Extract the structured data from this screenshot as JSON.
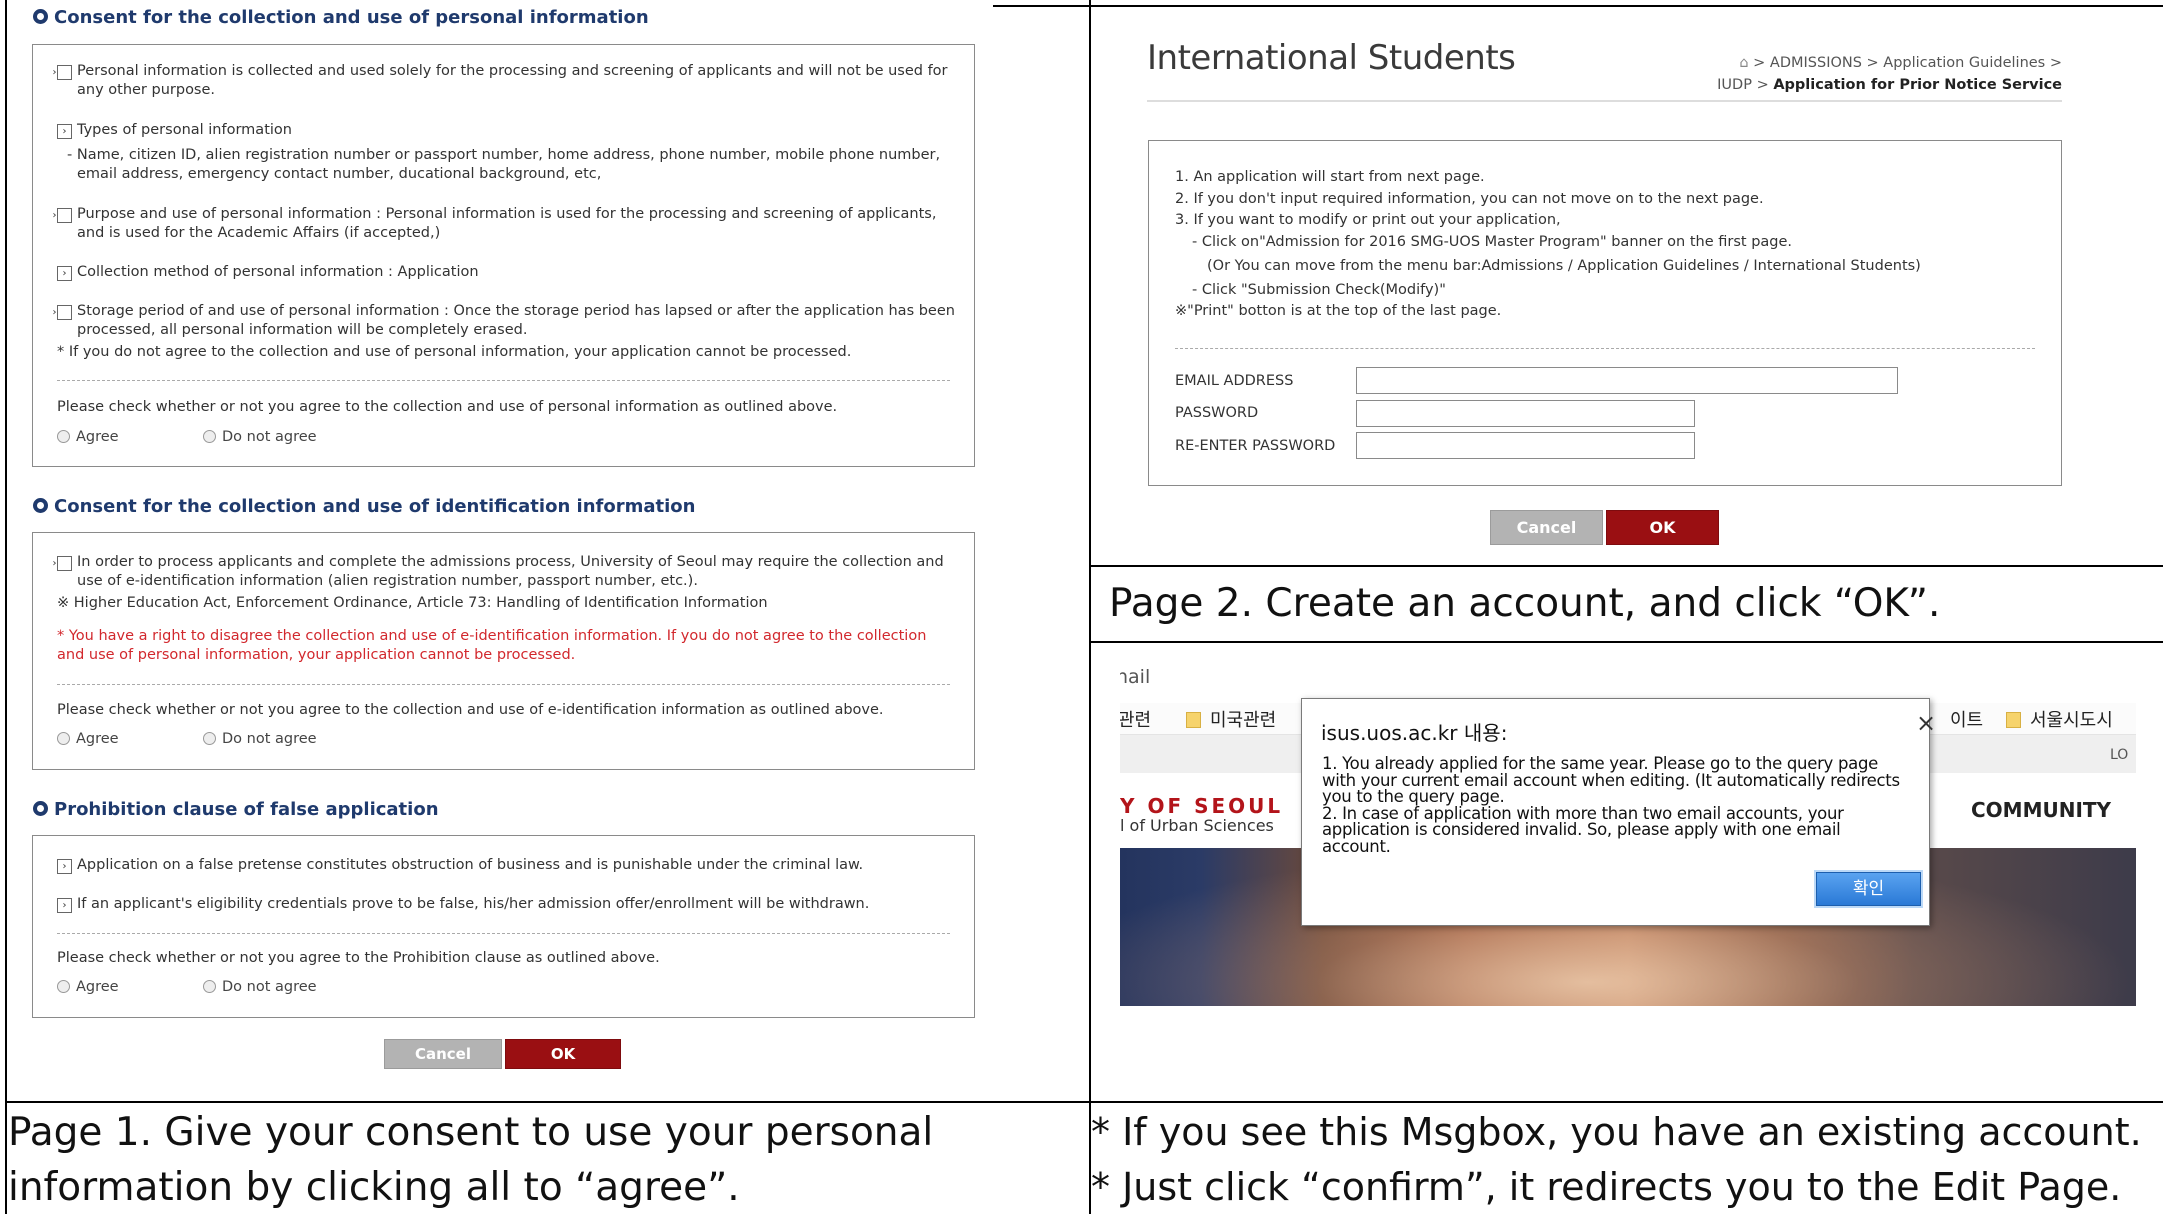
{
  "left": {
    "sections": [
      {
        "title": "Consent for the collection and use of personal information",
        "items": [
          "Personal information is collected and used solely for the processing and screening of applicants and will not be used for any other purpose.",
          "Types of personal information",
          "Purpose and use of personal information : Personal information is used for the processing and screening of applicants, and is used for the Academic Affairs (if accepted,)",
          "Collection method of personal information : Application",
          "Storage period of and use of personal information : Once the storage period has lapsed or after the application has been processed, all personal information will be completely erased."
        ],
        "sub_item": "- Name, citizen ID, alien registration number or passport number, home address, phone number, mobile phone number, email address, emergency contact number, ducational background, etc,",
        "note": "* If you do not agree to the collection and use of personal information, your application cannot be processed.",
        "question": "Please check whether or not you agree to the collection and use of personal information as outlined above.",
        "agree": "Agree",
        "disagree": "Do not agree"
      },
      {
        "title": "Consent for the collection and use of identification information",
        "items": [
          "In order to process applicants and complete the admissions process, University of Seoul may require the collection and use of e-identification information (alien registration number, passport number, etc.)."
        ],
        "law": "※ Higher Education Act, Enforcement Ordinance, Article 73: Handling of Identification Information",
        "note": "* You have a right to disagree the collection and use of e-identification information. If you do not agree to the collection and use of personal information, your application cannot be processed.",
        "question": "Please check whether or not you agree to the collection and use of e-identification information as outlined above.",
        "agree": "Agree",
        "disagree": "Do not agree"
      },
      {
        "title": "Prohibition clause of false application",
        "items": [
          "Application on a false pretense constitutes obstruction of business and is punishable under the criminal law.",
          "If an applicant's eligibility credentials prove to be false, his/her admission offer/enrollment will be withdrawn."
        ],
        "question": "Please check whether or not you agree to the Prohibition clause as outlined above.",
        "agree": "Agree",
        "disagree": "Do not agree"
      }
    ],
    "cancel": "Cancel",
    "ok": "OK",
    "caption_line1": "Page 1. Give your consent to use your personal",
    "caption_line2": "information by clicking all to “agree”."
  },
  "right_top": {
    "title": "International Students",
    "breadcrumb_line1": "> ADMISSIONS > Application Guidelines >",
    "breadcrumb_line2_a": "IUDP > ",
    "breadcrumb_line2_b": "Application for Prior Notice Service",
    "instructions": [
      "1. An application will start from next page.",
      "2. If you don't input required information, you can not move on to the next page.",
      "3. If you want to modify or print out your application,",
      "- Click on\"Admission for 2016 SMG-UOS Master Program\" banner on the first page.",
      "(Or You can move from the menu bar:Admissions / Application Guidelines / International Students)",
      "- Click \"Submission Check(Modify)\"",
      "※\"Print\" botton is at the top of the last page."
    ],
    "email_label": "EMAIL ADDRESS",
    "password_label": "PASSWORD",
    "reenter_label": "RE-ENTER PASSWORD",
    "cancel": "Cancel",
    "ok": "OK",
    "caption": "Page 2. Create an account, and click “OK”."
  },
  "right_bottom": {
    "partial_tab": "nail",
    "bookmark_1": "관련",
    "bookmark_2": "미국관련",
    "bookmark_3": "이트",
    "bookmark_4": "서울시도시",
    "partial_right": "LO",
    "univ_name": "Y OF SEOUL",
    "univ_sub": "l of Urban Sciences",
    "community": "COMMUNITY",
    "dialog_title": "isus.uos.ac.kr 내용:",
    "dialog_close": "×",
    "dialog_lines": [
      "1. You already applied for the same year. Please go to the query page",
      "with your current email account when editing. (It automatically redirects",
      "you to the query page.",
      " 2. In case of application with more than two email accounts, your",
      "application is considered invalid. So, please apply with one email",
      "account."
    ],
    "dialog_confirm": "확인",
    "caption_line1": "* If you see this Msgbox, you have an existing account.",
    "caption_line2": "* Just click “confirm”, it redirects you to the Edit Page."
  }
}
